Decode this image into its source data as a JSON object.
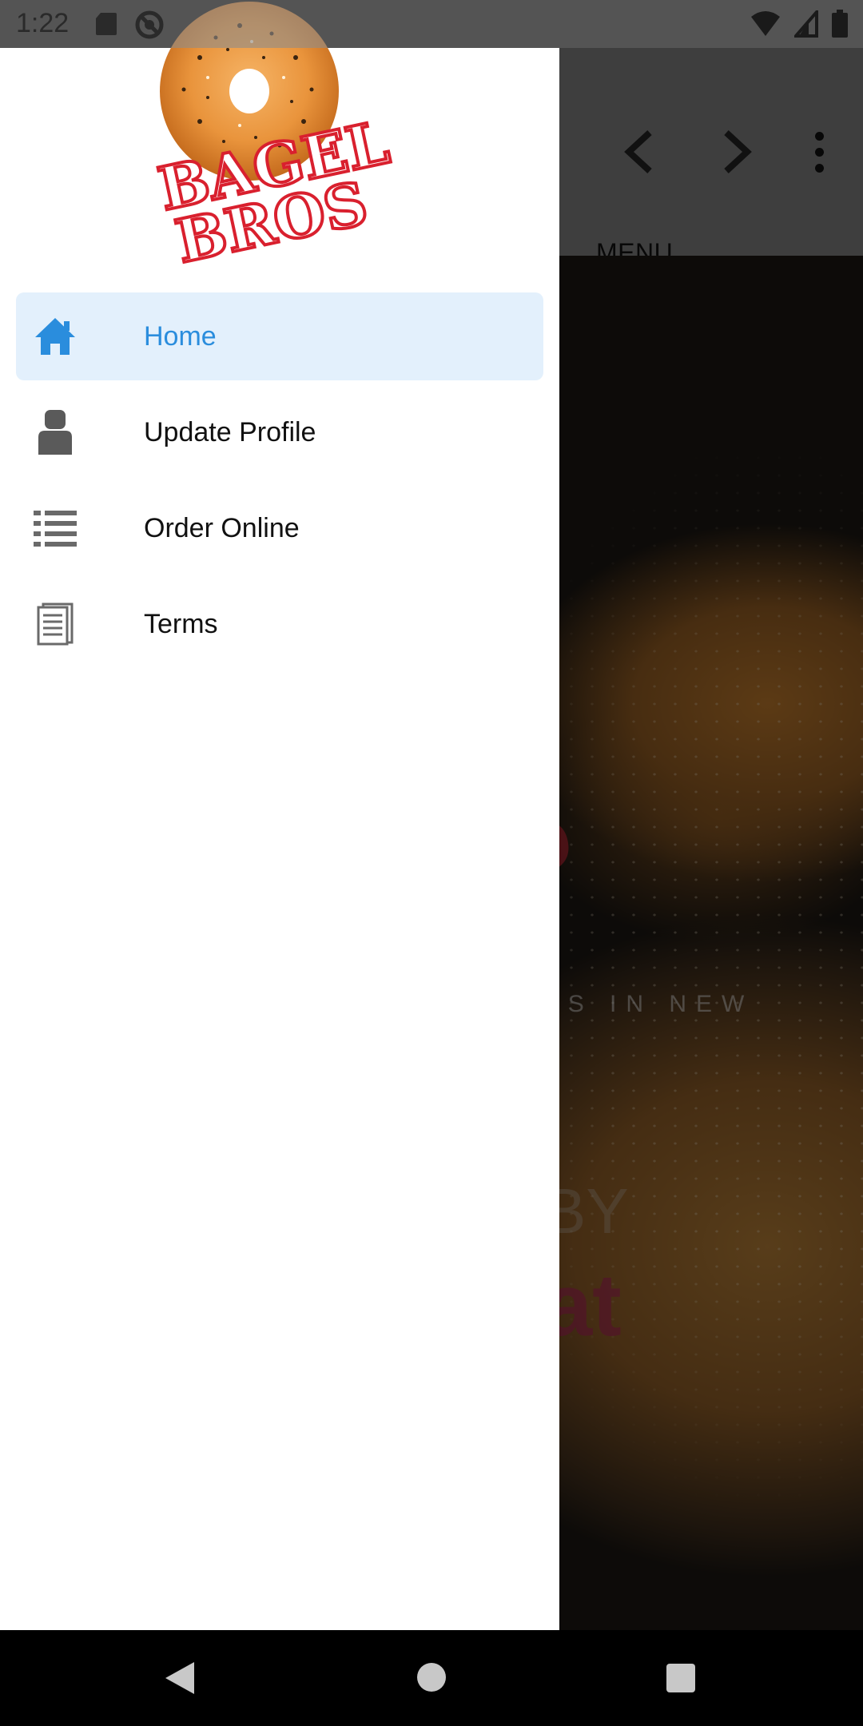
{
  "status_bar": {
    "time": "1:22"
  },
  "toolbar": {
    "menu_label": "MENU"
  },
  "hero": {
    "partial_text": "ELS IN NEW",
    "logo_fragment": "L\nS",
    "by_fragment": "BY",
    "at_fragment": "at"
  },
  "drawer": {
    "logo_line1": "BAGEL",
    "logo_line2": "BROS",
    "items": [
      {
        "label": "Home",
        "icon": "home-icon",
        "active": true
      },
      {
        "label": "Update Profile",
        "icon": "person-icon",
        "active": false
      },
      {
        "label": "Order Online",
        "icon": "list-icon",
        "active": false
      },
      {
        "label": "Terms",
        "icon": "document-icon",
        "active": false
      }
    ]
  },
  "colors": {
    "accent": "#2A8DDD",
    "active_bg": "#E3F0FC",
    "brand_red": "#D9202E"
  }
}
